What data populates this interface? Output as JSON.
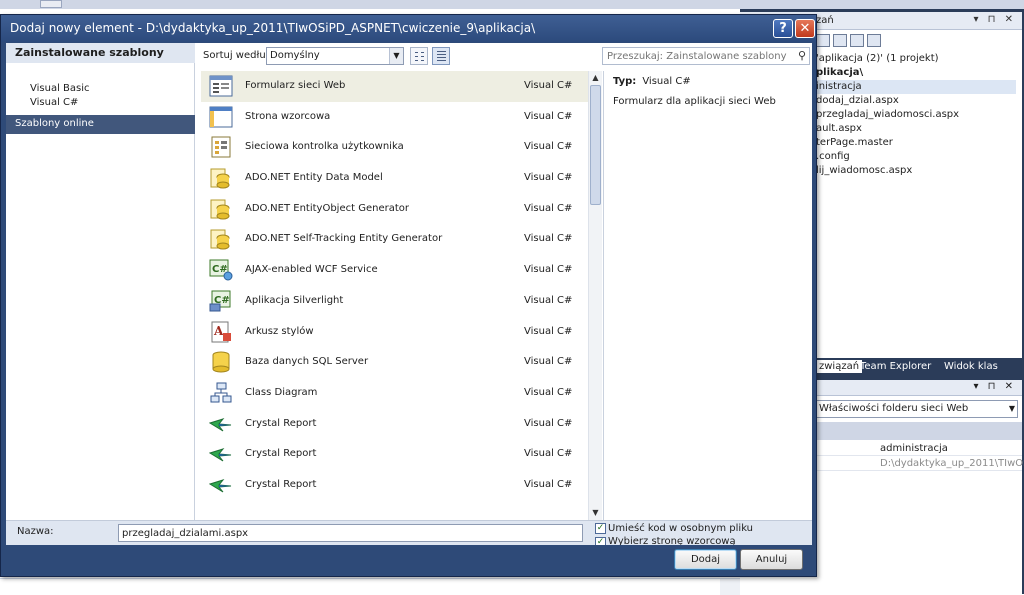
{
  "dialog": {
    "title": "Dodaj nowy element - D:\\dydaktyka_up_2011\\TIwOSiPD_ASPNET\\cwiczenie_9\\aplikacja\\",
    "help_glyph": "?",
    "close_glyph": "✕"
  },
  "left_pane": {
    "installed_header": "Zainstalowane szablony",
    "items": [
      "Visual Basic",
      "Visual C#"
    ],
    "online": "Szablony online"
  },
  "toolbar": {
    "sort_label": "Sortuj według:",
    "sort_value": "Domyślny",
    "search_placeholder": "Przeszukaj: Zainstalowane szablony"
  },
  "templates": [
    {
      "name": "Formularz sieci Web",
      "lang": "Visual C#",
      "icon": "web-form-icon"
    },
    {
      "name": "Strona wzorcowa",
      "lang": "Visual C#",
      "icon": "master-page-icon"
    },
    {
      "name": "Sieciowa kontrolka użytkownika",
      "lang": "Visual C#",
      "icon": "user-control-icon"
    },
    {
      "name": "ADO.NET Entity Data Model",
      "lang": "Visual C#",
      "icon": "entity-model-icon"
    },
    {
      "name": "ADO.NET EntityObject Generator",
      "lang": "Visual C#",
      "icon": "entity-generator-icon"
    },
    {
      "name": "ADO.NET Self-Tracking Entity Generator",
      "lang": "Visual C#",
      "icon": "self-tracking-icon"
    },
    {
      "name": "AJAX-enabled WCF Service",
      "lang": "Visual C#",
      "icon": "wcf-service-icon"
    },
    {
      "name": "Aplikacja Silverlight",
      "lang": "Visual C#",
      "icon": "silverlight-icon"
    },
    {
      "name": "Arkusz stylów",
      "lang": "Visual C#",
      "icon": "stylesheet-icon"
    },
    {
      "name": "Baza danych SQL Server",
      "lang": "Visual C#",
      "icon": "database-icon"
    },
    {
      "name": "Class Diagram",
      "lang": "Visual C#",
      "icon": "class-diagram-icon"
    },
    {
      "name": "Crystal Report",
      "lang": "Visual C#",
      "icon": "crystal-report-icon"
    },
    {
      "name": "Crystal Report",
      "lang": "Visual C#",
      "icon": "crystal-report-icon"
    },
    {
      "name": "Crystal Report",
      "lang": "Visual C#",
      "icon": "crystal-report-icon"
    }
  ],
  "details": {
    "type_label": "Typ:",
    "type_value": "Visual C#",
    "description": "Formularz dla aplikacji sieci Web"
  },
  "bottom": {
    "name_label": "Nazwa:",
    "name_value": "przegladaj_dzialami.aspx",
    "chk1": "Umieść kod w osobnym pliku",
    "chk2": "Wybierz stronę wzorcową"
  },
  "buttons": {
    "add": "Dodaj",
    "cancel": "Anuluj"
  },
  "ide": {
    "sol_header": "zań",
    "tree": [
      "'aplikacja (2)' (1 projekt)",
      "plikacja\\",
      "inistracja",
      "dodaj_dzial.aspx",
      "przegladaj_wiadomosci.aspx",
      "ault.aspx",
      "terPage.master",
      ".config",
      "lij_wiadomosc.aspx"
    ],
    "tabs": [
      "związań",
      "Team Explorer",
      "Widok klas"
    ],
    "prop_combo": "Właściwości folderu sieci Web",
    "prop_values": [
      "administracja",
      "D:\\dydaktyka_up_2011\\TIwOSiPD"
    ]
  }
}
